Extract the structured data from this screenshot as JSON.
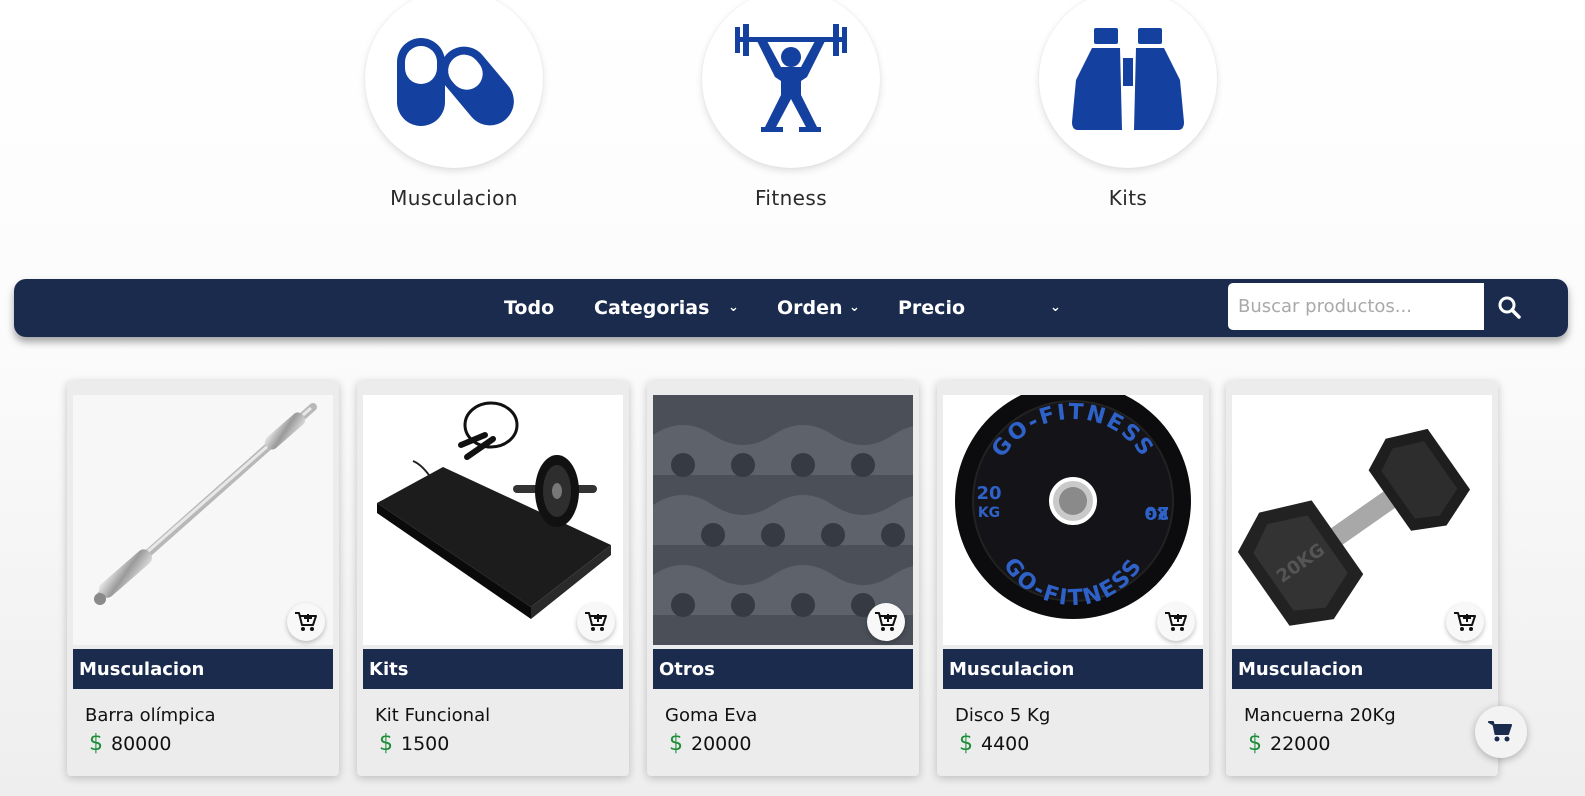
{
  "categories": [
    {
      "label": "Musculacion",
      "icon": "pills-icon"
    },
    {
      "label": "Fitness",
      "icon": "weightlifter-icon"
    },
    {
      "label": "Kits",
      "icon": "binoculars-icon"
    }
  ],
  "filters": {
    "todo": "Todo",
    "categorias": "Categorias",
    "orden": "Orden",
    "precio": "Precio",
    "chevron": "⌄"
  },
  "search": {
    "placeholder": "Buscar productos...",
    "value": ""
  },
  "currency": "$",
  "products": [
    {
      "name": "Barra olímpica",
      "price": "80000",
      "category": "Musculacion",
      "image": "olympic-bar"
    },
    {
      "name": "Kit Funcional",
      "price": "1500",
      "category": "Kits",
      "image": "functional-kit"
    },
    {
      "name": "Goma Eva",
      "price": "20000",
      "category": "Otros",
      "image": "eva-mat"
    },
    {
      "name": "Disco 5 Kg",
      "price": "4400",
      "category": "Musculacion",
      "image": "weight-plate",
      "plate_text_top": "GO-FITNESS",
      "plate_text_bottom": "GO-FITNESS",
      "plate_weight": "20",
      "plate_unit": "KG"
    },
    {
      "name": "Mancuerna 20Kg",
      "price": "22000",
      "category": "Musculacion",
      "image": "dumbbell",
      "dumbbell_label": "20KG"
    }
  ],
  "colors": {
    "navy": "#1b2b4e",
    "icon_blue": "#1440a0",
    "price_green": "#1e8d3a"
  }
}
